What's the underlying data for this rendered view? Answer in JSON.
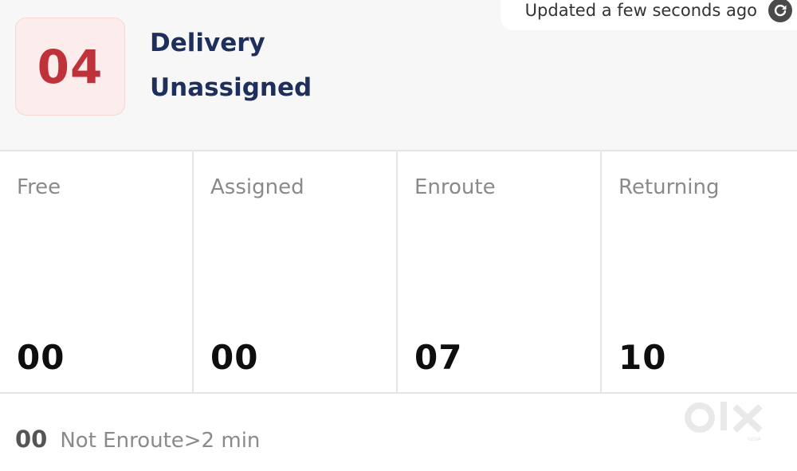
{
  "status": {
    "updated_text": "Updated a few seconds ago",
    "refresh_icon": "refresh-icon"
  },
  "summary": {
    "count": "04",
    "title_line1": "Delivery",
    "title_line2": "Unassigned",
    "accent_color": "#c0323a",
    "title_color": "#1e2f5c"
  },
  "stats": [
    {
      "label": "Free",
      "value": "00"
    },
    {
      "label": "Assigned",
      "value": "00"
    },
    {
      "label": "Enroute",
      "value": "07"
    },
    {
      "label": "Returning",
      "value": "10"
    }
  ],
  "footer": {
    "count": "00",
    "label": "Not Enroute>2 min"
  },
  "watermark": {
    "text": "OLX",
    "subtext": "INDIA"
  }
}
